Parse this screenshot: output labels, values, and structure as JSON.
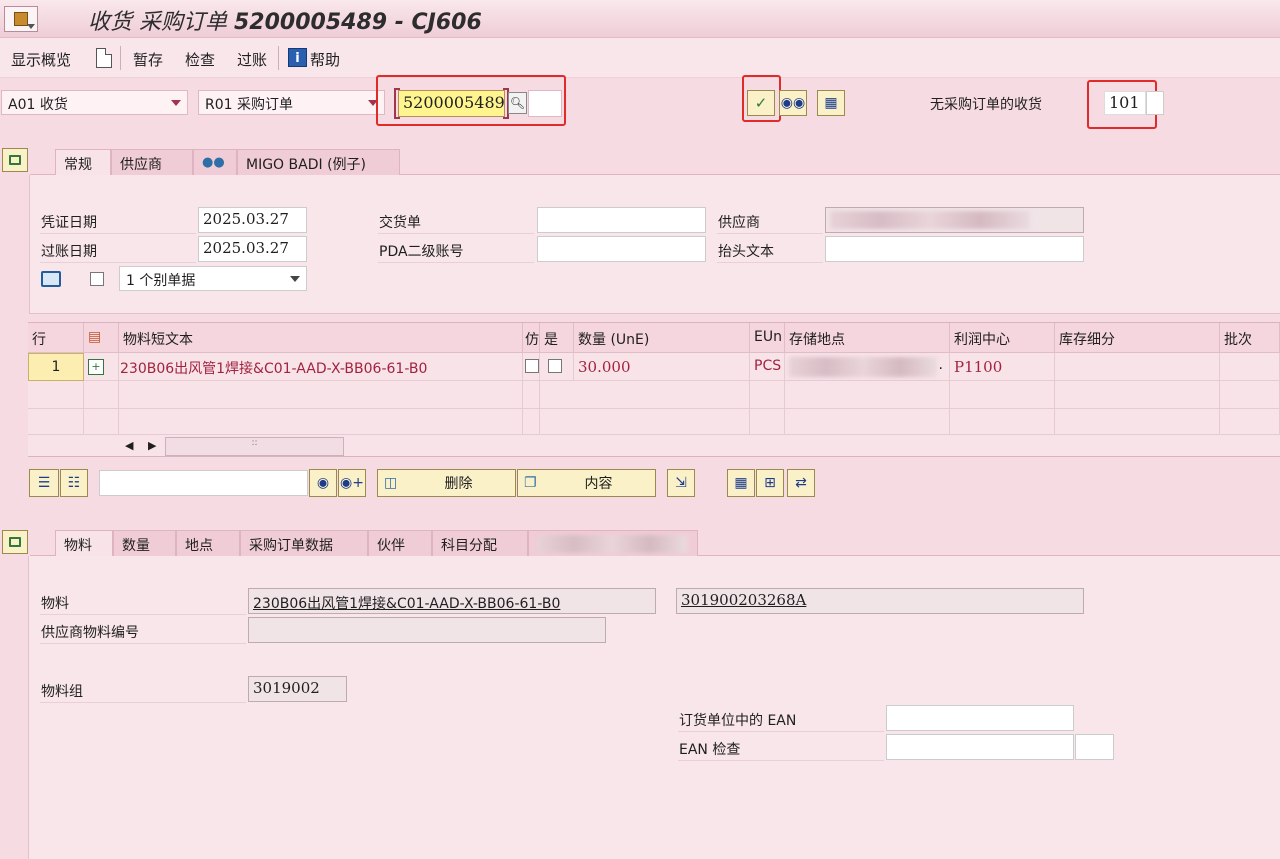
{
  "title": {
    "prefix": "收货 采购订单",
    "doc": "5200005489 - CJ606"
  },
  "menu": {
    "overview": "显示概览",
    "hold": "暂存",
    "check": "检查",
    "post": "过账",
    "help": "帮助"
  },
  "selection": {
    "action": "A01 收货",
    "reference": "R01 采购订单",
    "po_number": "5200005489",
    "no_po_label": "无采购订单的收货",
    "movement_type": "101"
  },
  "header_tabs": [
    "常规",
    "供应商",
    "MIGO BADI (例子)"
  ],
  "header": {
    "doc_date_label": "凭证日期",
    "doc_date": "2025.03.27",
    "post_date_label": "过账日期",
    "post_date": "2025.03.27",
    "delivery_note_label": "交货单",
    "pda_label": "PDA二级账号",
    "vendor_label": "供应商",
    "header_text_label": "抬头文本",
    "slip_option": "1 个别单据"
  },
  "grid": {
    "headers": [
      "行",
      "物料短文本",
      "仿",
      "是",
      "数量 (UnE)",
      "EUn",
      "存储地点",
      "利润中心",
      "库存细分",
      "批次"
    ],
    "rows": [
      {
        "line": "1",
        "material_text": "230B06出风管1焊接&C01-AAD-X-BB06-61-B0",
        "qty": "30.000",
        "unit": "PCS",
        "dot": ".",
        "profit_center": "P1100"
      }
    ]
  },
  "grid_toolbar": {
    "delete": "删除",
    "contents": "内容"
  },
  "detail_tabs": [
    "物料",
    "数量",
    "地点",
    "采购订单数据",
    "伙伴",
    "科目分配"
  ],
  "detail": {
    "material_label": "物料",
    "material_text": "230B06出风管1焊接&C01-AAD-X-BB06-61-B0",
    "material_number": "301900203268A",
    "vendor_material_label": "供应商物料编号",
    "material_group_label": "物料组",
    "material_group": "3019002",
    "ean_order_unit_label": "订货单位中的 EAN",
    "ean_check_label": "EAN 检查"
  }
}
